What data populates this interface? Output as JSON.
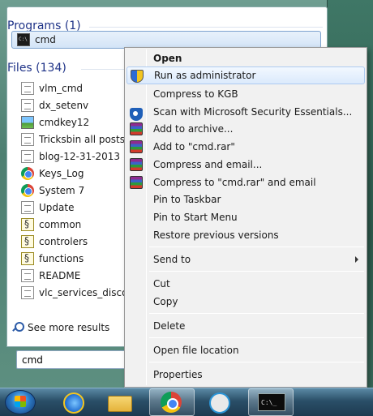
{
  "start_menu": {
    "programs_header": "Programs (1)",
    "program_item": "cmd",
    "files_header": "Files (134)",
    "files": [
      {
        "label": "vlm_cmd",
        "icon": "document-icon"
      },
      {
        "label": "dx_setenv",
        "icon": "document-icon"
      },
      {
        "label": "cmdkey12",
        "icon": "image-icon"
      },
      {
        "label": "Tricksbin all posts",
        "icon": "document-icon"
      },
      {
        "label": "blog-12-31-2013",
        "icon": "document-icon"
      },
      {
        "label": "Keys_Log",
        "icon": "chrome-icon"
      },
      {
        "label": "System 7",
        "icon": "chrome-icon"
      },
      {
        "label": "Update",
        "icon": "document-icon"
      },
      {
        "label": "common",
        "icon": "script-icon"
      },
      {
        "label": "controlers",
        "icon": "script-icon"
      },
      {
        "label": "functions",
        "icon": "script-icon"
      },
      {
        "label": "README",
        "icon": "document-icon"
      },
      {
        "label": "vlc_services_discove",
        "icon": "document-icon"
      }
    ],
    "see_more": "See more results",
    "search_value": "cmd"
  },
  "context_menu": {
    "items": [
      {
        "label": "Open",
        "bold": true,
        "icon": ""
      },
      {
        "label": "Run as administrator",
        "icon": "uac-shield-icon",
        "hover": true
      },
      {
        "label": "Compress to KGB",
        "icon": ""
      },
      {
        "label": "Scan with Microsoft Security Essentials...",
        "icon": "security-essentials-icon"
      },
      {
        "label": "Add to archive...",
        "icon": "winrar-icon"
      },
      {
        "label": "Add to \"cmd.rar\"",
        "icon": "winrar-icon"
      },
      {
        "label": "Compress and email...",
        "icon": "winrar-icon"
      },
      {
        "label": "Compress to \"cmd.rar\" and email",
        "icon": "winrar-icon"
      },
      {
        "label": "Pin to Taskbar",
        "icon": ""
      },
      {
        "label": "Pin to Start Menu",
        "icon": ""
      },
      {
        "label": "Restore previous versions",
        "icon": ""
      },
      {
        "label": "Send to",
        "icon": "",
        "submenu": true
      },
      {
        "label": "Cut",
        "icon": ""
      },
      {
        "label": "Copy",
        "icon": ""
      },
      {
        "label": "Delete",
        "icon": ""
      },
      {
        "label": "Open file location",
        "icon": ""
      },
      {
        "label": "Properties",
        "icon": ""
      }
    ]
  },
  "taskbar": {
    "icons": [
      "start-orb-icon",
      "internet-explorer-icon",
      "file-explorer-icon",
      "chrome-icon",
      "uplay-icon",
      "command-prompt-icon"
    ]
  }
}
